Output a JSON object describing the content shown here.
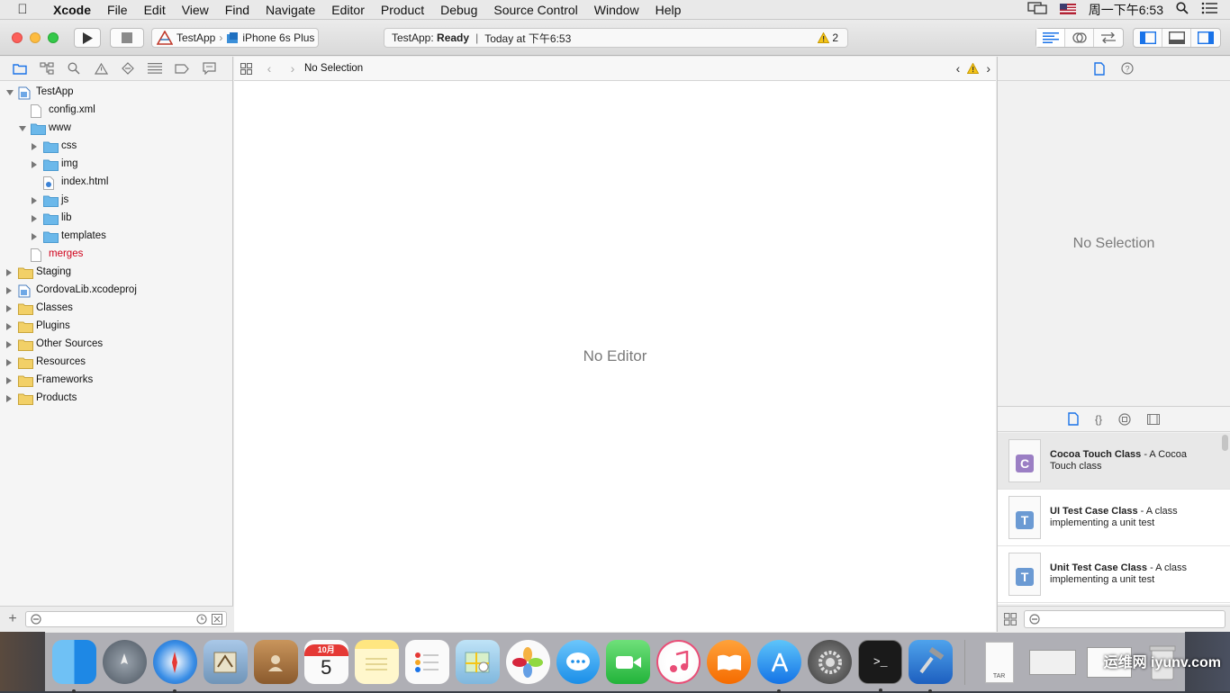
{
  "menubar": {
    "app_name": "Xcode",
    "items": [
      "File",
      "Edit",
      "View",
      "Find",
      "Navigate",
      "Editor",
      "Product",
      "Debug",
      "Source Control",
      "Window",
      "Help"
    ],
    "clock": "周一下午6:53"
  },
  "toolbar": {
    "scheme_target": "TestApp",
    "scheme_device": "iPhone 6s Plus",
    "status_app": "TestApp:",
    "status_state": "Ready",
    "status_time": "Today at 下午6:53",
    "warning_count": "2"
  },
  "navigator": {
    "tree": [
      {
        "label": "TestApp",
        "level": 0,
        "disclosure": "open",
        "icon": "project-icon"
      },
      {
        "label": "config.xml",
        "level": 1,
        "disclosure": "none",
        "icon": "file-icon"
      },
      {
        "label": "www",
        "level": 1,
        "disclosure": "open",
        "icon": "folder-blue"
      },
      {
        "label": "css",
        "level": 2,
        "disclosure": "closed",
        "icon": "folder-blue"
      },
      {
        "label": "img",
        "level": 2,
        "disclosure": "closed",
        "icon": "folder-blue"
      },
      {
        "label": "index.html",
        "level": 2,
        "disclosure": "none",
        "icon": "html-file-icon"
      },
      {
        "label": "js",
        "level": 2,
        "disclosure": "closed",
        "icon": "folder-blue"
      },
      {
        "label": "lib",
        "level": 2,
        "disclosure": "closed",
        "icon": "folder-blue"
      },
      {
        "label": "templates",
        "level": 2,
        "disclosure": "closed",
        "icon": "folder-blue"
      },
      {
        "label": "merges",
        "level": 1,
        "disclosure": "none",
        "icon": "file-icon",
        "color": "#d0021b"
      },
      {
        "label": "Staging",
        "level": 0,
        "disclosure": "closed",
        "icon": "folder-yellow"
      },
      {
        "label": "CordovaLib.xcodeproj",
        "level": 0,
        "disclosure": "closed",
        "icon": "project-icon"
      },
      {
        "label": "Classes",
        "level": 0,
        "disclosure": "closed",
        "icon": "folder-yellow"
      },
      {
        "label": "Plugins",
        "level": 0,
        "disclosure": "closed",
        "icon": "folder-yellow"
      },
      {
        "label": "Other Sources",
        "level": 0,
        "disclosure": "closed",
        "icon": "folder-yellow"
      },
      {
        "label": "Resources",
        "level": 0,
        "disclosure": "closed",
        "icon": "folder-yellow"
      },
      {
        "label": "Frameworks",
        "level": 0,
        "disclosure": "closed",
        "icon": "folder-yellow"
      },
      {
        "label": "Products",
        "level": 0,
        "disclosure": "closed",
        "icon": "folder-yellow"
      }
    ]
  },
  "editor": {
    "jumpbar_label": "No Selection",
    "empty_text": "No Editor"
  },
  "inspector": {
    "empty_text": "No Selection"
  },
  "library": {
    "items": [
      {
        "title": "Cocoa Touch Class",
        "desc": " - A Cocoa Touch class",
        "badge": "C",
        "badge_color": "#9b7fc4"
      },
      {
        "title": "UI Test Case Class",
        "desc": " - A class implementing a unit test",
        "badge": "T",
        "badge_color": "#6b9ad3"
      },
      {
        "title": "Unit Test Case Class",
        "desc": " - A class implementing a unit test",
        "badge": "T",
        "badge_color": "#6b9ad3"
      }
    ]
  },
  "dock": {
    "calendar_month": "10月",
    "calendar_day": "5",
    "terminal_prompt": ">_",
    "archive_label": "TAR",
    "watermark": "运维网 iyunv.com"
  },
  "colors": {
    "accent": "#1a73e8",
    "warning": "#f5c518",
    "close": "#fc605b",
    "minimize": "#fdbc40",
    "zoom": "#34c84a"
  }
}
